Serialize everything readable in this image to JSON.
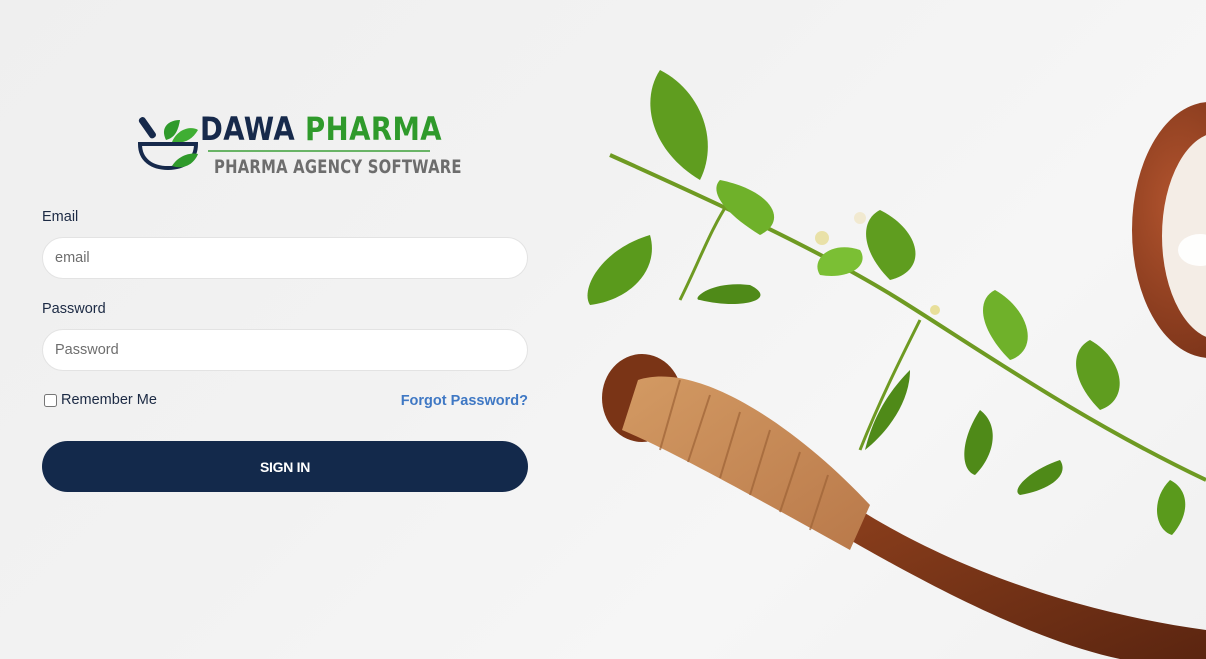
{
  "brand": {
    "name_part1": "DAWA",
    "name_part2": "PHARMA",
    "tagline": "PHARMA AGENCY SOFTWARE",
    "colors": {
      "navy": "#16294b",
      "green": "#2f9a2b",
      "gray": "#6d6d6d"
    }
  },
  "form": {
    "email": {
      "label": "Email",
      "placeholder": "email",
      "value": ""
    },
    "password": {
      "label": "Password",
      "placeholder": "Password",
      "value": ""
    },
    "remember_label": "Remember Me",
    "remember_checked": false,
    "forgot_label": "Forgot Password?",
    "submit_label": "SIGN IN"
  },
  "theme": {
    "button_color": "#13294b",
    "link_color": "#3f78c4"
  },
  "hero": {
    "icons": [
      "herb-sprig",
      "wooden-pestle",
      "clay-mortar"
    ]
  }
}
